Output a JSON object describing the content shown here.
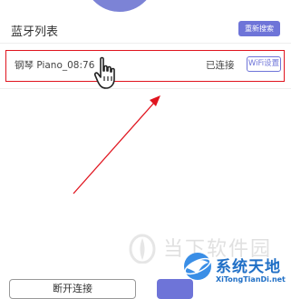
{
  "header": {
    "title": "蓝牙列表",
    "rescan_label": "重新搜索"
  },
  "devices": [
    {
      "name": "钢琴 Piano_08:76",
      "status": "已连接",
      "wifi_label": "WiFi设置"
    }
  ],
  "footer": {
    "disconnect_label": "断开连接"
  },
  "watermarks": {
    "site1": "当下软件园",
    "site2": "系统天地",
    "site2_url": "XiTongTianDi.net"
  },
  "colors": {
    "accent": "#6e74d8",
    "highlight_border": "#e0141e",
    "annotation_arrow": "#e0141e"
  },
  "icons": {
    "cursor": "hand-pointer-icon",
    "arrow": "annotation-arrow-icon"
  }
}
